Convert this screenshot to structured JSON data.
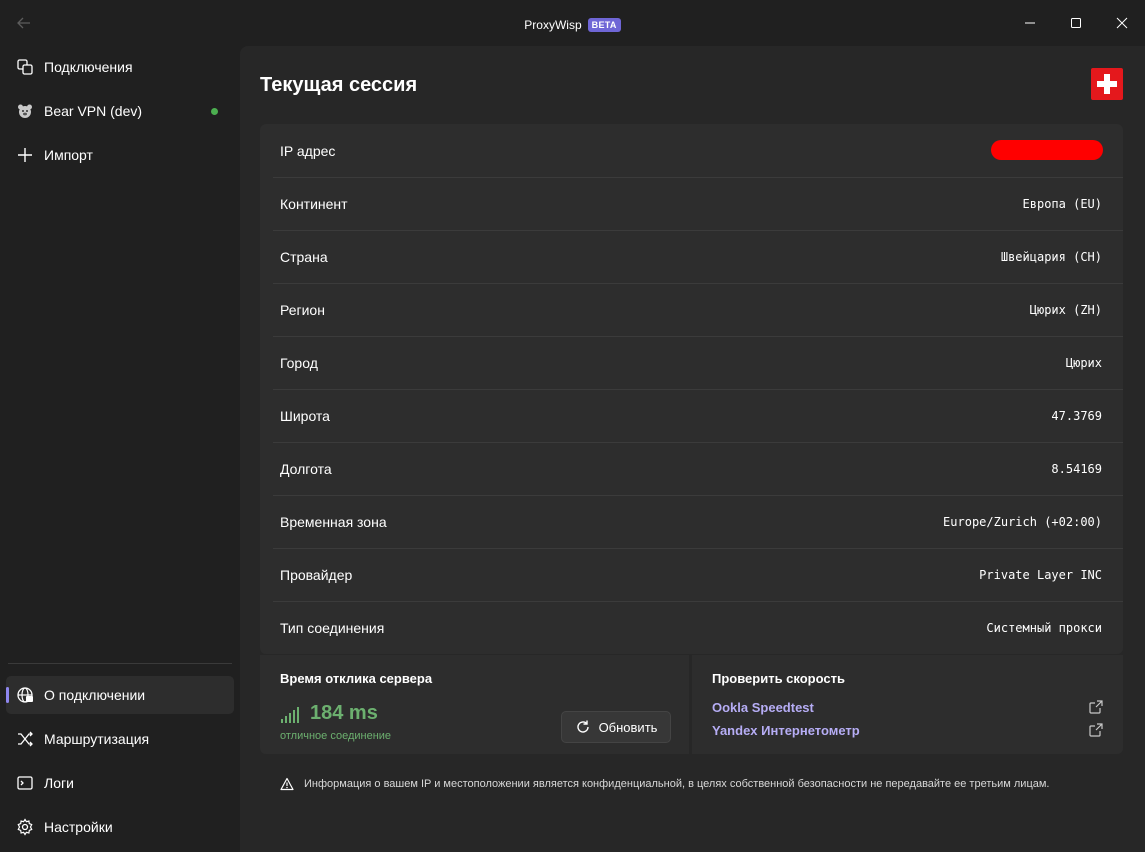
{
  "window": {
    "app_name": "ProxyWisp",
    "badge": "BETA"
  },
  "sidebar": {
    "items": [
      {
        "id": "connections",
        "label": "Подключения",
        "icon": "connections-icon"
      },
      {
        "id": "bear-vpn",
        "label": "Bear VPN (dev)",
        "icon": "bear-icon",
        "status": "active"
      },
      {
        "id": "import",
        "label": "Импорт",
        "icon": "plus-icon"
      }
    ],
    "bottom_items": [
      {
        "id": "about-connection",
        "label": "О подключении",
        "icon": "globe-icon",
        "selected": true
      },
      {
        "id": "routing",
        "label": "Маршрутизация",
        "icon": "shuffle-icon"
      },
      {
        "id": "logs",
        "label": "Логи",
        "icon": "log-icon"
      },
      {
        "id": "settings",
        "label": "Настройки",
        "icon": "gear-icon"
      }
    ]
  },
  "main": {
    "title": "Текущая сессия",
    "flag_icon": "swiss-flag-icon",
    "session": [
      {
        "key": "IP адрес",
        "value": ""
      },
      {
        "key": "Континент",
        "value": "Европа (EU)"
      },
      {
        "key": "Страна",
        "value": "Швейцария (CH)"
      },
      {
        "key": "Регион",
        "value": "Цюрих (ZH)"
      },
      {
        "key": "Город",
        "value": "Цюрих"
      },
      {
        "key": "Широта",
        "value": "47.3769"
      },
      {
        "key": "Долгота",
        "value": "8.54169"
      },
      {
        "key": "Временная зона",
        "value": "Europe/Zurich (+02:00)"
      },
      {
        "key": "Провайдер",
        "value": "Private Layer INC"
      },
      {
        "key": "Тип соединения",
        "value": "Системный прокси"
      }
    ],
    "ping": {
      "title": "Время отклика сервера",
      "value": "184 ms",
      "quality": "отличное соединение",
      "refresh_label": "Обновить"
    },
    "speed": {
      "title": "Проверить скорость",
      "links": [
        "Ookla Speedtest",
        "Yandex Интернетометр"
      ]
    },
    "notice": "Информация о вашем IP и местоположении является конфиденциальной, в целях собственной безопасности не передавайте ее третьим лицам."
  },
  "colors": {
    "accent": "#8e86ef",
    "link": "#b6adf5",
    "good": "#6cb06f",
    "status_dot": "#4caf50"
  }
}
